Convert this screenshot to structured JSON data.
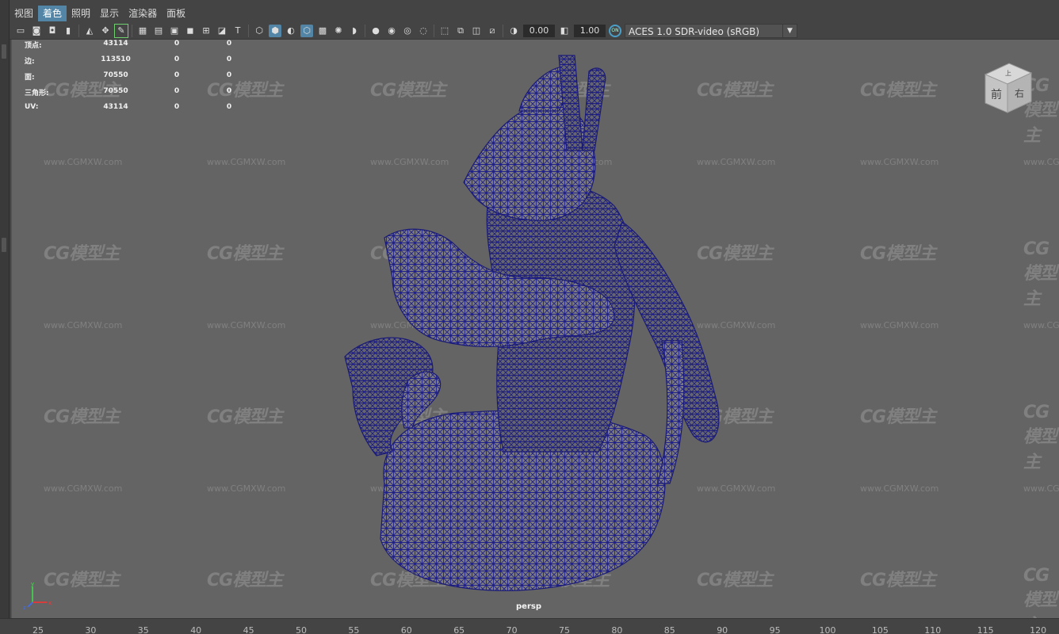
{
  "menu": {
    "items": [
      {
        "label": "视图",
        "active": false
      },
      {
        "label": "着色",
        "active": true
      },
      {
        "label": "照明",
        "active": false
      },
      {
        "label": "显示",
        "active": false
      },
      {
        "label": "渲染器",
        "active": false
      },
      {
        "label": "面板",
        "active": false
      }
    ]
  },
  "toolbar": {
    "exposure_value": "0.00",
    "gamma_value": "1.00",
    "color_management": "ACES 1.0 SDR-video (sRGB)",
    "icons": [
      "camera-select-icon",
      "camera-lock-icon",
      "camera-attributes-icon",
      "bookmark-icon",
      "image-plane-icon",
      "2d-pan-zoom-icon",
      "grease-pencil-icon",
      "grid-icon",
      "film-gate-icon",
      "resolution-gate-icon",
      "gate-mask-icon",
      "field-chart-icon",
      "safe-action-icon",
      "safe-title-icon",
      "wireframe-icon",
      "smooth-shade-icon",
      "default-material-icon",
      "wireframe-on-shaded-icon",
      "xray-icon",
      "use-all-lights-icon",
      "shadows-icon",
      "ambient-occlusion-icon",
      "motion-blur-icon",
      "antialiasing-icon",
      "depth-of-field-icon",
      "isolate-select-icon",
      "xray-joints-icon",
      "xray-active-icon",
      "backface-culling-icon",
      "exposure-icon",
      "gamma-icon",
      "color-management-icon"
    ]
  },
  "hud": {
    "rows": [
      {
        "label": "顶点:",
        "c1": "43114",
        "c2": "0",
        "c3": "0"
      },
      {
        "label": "边:",
        "c1": "113510",
        "c2": "0",
        "c3": "0"
      },
      {
        "label": "面:",
        "c1": "70550",
        "c2": "0",
        "c3": "0"
      },
      {
        "label": "三角形:",
        "c1": "70550",
        "c2": "0",
        "c3": "0"
      },
      {
        "label": "UV:",
        "c1": "43114",
        "c2": "0",
        "c3": "0"
      }
    ]
  },
  "watermark": {
    "logo": "CG模型主",
    "url": "www.CGMXW.com"
  },
  "view_cube": {
    "top": "上",
    "front": "前",
    "right": "右"
  },
  "camera_label": "persp",
  "axis": {
    "x": "x",
    "y": "y",
    "z": "z"
  },
  "timeline": {
    "ticks": [
      "25",
      "30",
      "35",
      "40",
      "45",
      "50",
      "55",
      "60",
      "65",
      "70",
      "75",
      "80",
      "85",
      "90",
      "95",
      "100",
      "105",
      "110",
      "115",
      "120"
    ]
  },
  "colors": {
    "viewport_bg": "#646464",
    "wireframe": "#1f1f8a",
    "menu_active": "#5285a6"
  }
}
